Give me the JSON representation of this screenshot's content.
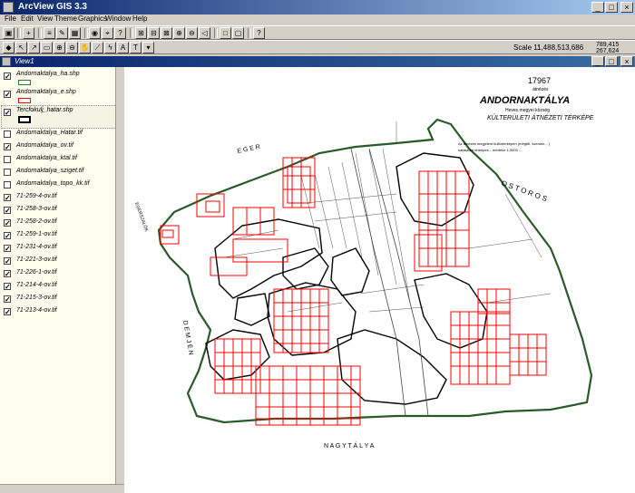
{
  "window": {
    "title": "ArcView GIS 3.3",
    "minimize_label": "_",
    "maximize_label": "□",
    "close_label": "×"
  },
  "menu": [
    "File",
    "Edit",
    "View",
    "Theme",
    "Graphics",
    "Window",
    "Help"
  ],
  "status": {
    "scale_label": "Scale 1:",
    "scale_value": "1,488,513,686",
    "coord_x": "789,415",
    "coord_y": "267,624"
  },
  "view": {
    "title": "View1"
  },
  "toc": {
    "items": [
      {
        "label": "Andornaktalya_ha.shp",
        "checked": true,
        "symbol": "green-box"
      },
      {
        "label": "Andornaktalya_e.shp",
        "checked": true,
        "symbol": "red-box"
      },
      {
        "label": "Tercfokulj_hatar.shp",
        "checked": true,
        "symbol": "black-box"
      },
      {
        "label": "Andornaktalya_Hatar.tif",
        "checked": false,
        "symbol": ""
      },
      {
        "label": "Andornaktalya_ov.tif",
        "checked": true,
        "symbol": ""
      },
      {
        "label": "Andornaktalya_ktal.tif",
        "checked": false,
        "symbol": ""
      },
      {
        "label": "Andornaktalya_sziget.tif",
        "checked": false,
        "symbol": ""
      },
      {
        "label": "Andornaktalya_topo_kk.tif",
        "checked": false,
        "symbol": ""
      },
      {
        "label": "71-259-4-ov.tif",
        "checked": true,
        "symbol": ""
      },
      {
        "label": "71-258-3-ov.tif",
        "checked": true,
        "symbol": ""
      },
      {
        "label": "71-258-2-ov.tif",
        "checked": true,
        "symbol": ""
      },
      {
        "label": "71-259-1-ov.tif",
        "checked": true,
        "symbol": ""
      },
      {
        "label": "71-231-4-ov.tif",
        "checked": true,
        "symbol": ""
      },
      {
        "label": "71-221-3-ov.tif",
        "checked": true,
        "symbol": ""
      },
      {
        "label": "71-226-1-ov.tif",
        "checked": true,
        "symbol": ""
      },
      {
        "label": "71-214-4-ov.tif",
        "checked": true,
        "symbol": ""
      },
      {
        "label": "71-215-3-ov.tif",
        "checked": true,
        "symbol": ""
      },
      {
        "label": "71-213-4-ov.tif",
        "checked": true,
        "symbol": ""
      }
    ]
  },
  "map": {
    "title": "ANDORNAKTÁLYA",
    "subtitle": "Heves megyei község",
    "heading": "KÜLTERÜLETI ÁTNÉZETI TÉRKÉPE",
    "number": "17967",
    "number_sub": "átnézés",
    "note_line1": "Az átnézés megjelent kultúrtérképen (mégtől, szeméz... )",
    "note_line2": "kataszteri térképek... mértéke 1:5000 ...",
    "neighbor_north": "E G E R",
    "neighbor_east": "O S T O R O S",
    "neighbor_west": "D E M J É N",
    "neighbor_south": "N A G Y T Á L Y A",
    "neighbor_nw": "EGERSZALÓK",
    "neighbor_nw2": "SZALÓK",
    "colors": {
      "boundary": "#2a5a2a",
      "parcels": "#ff0000",
      "outline": "#000000"
    }
  },
  "tools": [
    "save",
    "add",
    "props",
    "table",
    "layout",
    "zoomin",
    "zoomout",
    "full",
    "pan",
    "select",
    "query",
    "edit",
    "measure",
    "text",
    "label",
    "help",
    "cursor",
    "id",
    "zin",
    "zout",
    "pan2",
    "measure2",
    "label2",
    "text2"
  ]
}
